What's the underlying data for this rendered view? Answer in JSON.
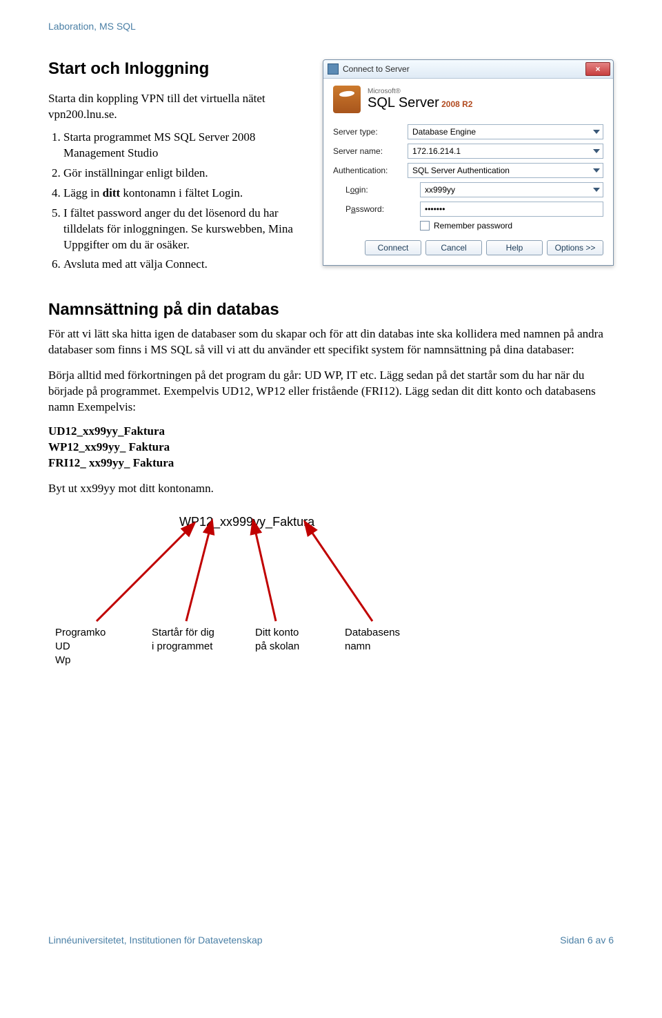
{
  "doc_header": "Laboration, MS SQL",
  "section1": {
    "title": "Start och Inloggning",
    "intro": "Starta din koppling VPN till det virtuella nätet vpn200.lnu.se.",
    "items": {
      "i1": "Starta programmet MS SQL Server 2008 Management Studio",
      "i2": "Gör inställningar enligt bilden.",
      "i3_pre": "Lägg in ",
      "i3_bold": "ditt",
      "i3_post": " kontonamn i fältet Login.",
      "i4": "I fältet password anger du det lösenord du har tilldelats för inloggningen. Se kurswebben, Mina Uppgifter om du är osäker.",
      "i5": "Avsluta med att välja Connect."
    }
  },
  "dialog": {
    "title": "Connect to Server",
    "close": "×",
    "logo": {
      "ms": "Microsoft®",
      "sql": "SQL Server",
      "ver": "2008 R2"
    },
    "labels": {
      "server_type": "Server type:",
      "server_name": "Server name:",
      "auth": "Authentication:",
      "login_pre": "L",
      "login_u": "o",
      "login_post": "gin:",
      "password_pre": "P",
      "password_u": "a",
      "password_post": "ssword:",
      "remember": "Remember password"
    },
    "values": {
      "server_type": "Database Engine",
      "server_name": "172.16.214.1",
      "auth": "SQL Server Authentication",
      "login": "xx999yy",
      "password": "•••••••"
    },
    "buttons": {
      "connect": "Connect",
      "cancel": "Cancel",
      "help": "Help",
      "options": "Options >>"
    }
  },
  "section2": {
    "title": "Namnsättning på din databas",
    "p1": "För att vi lätt ska hitta igen de databaser som du skapar och för att din databas inte ska kollidera med namnen på andra databaser som finns i MS SQL så vill vi att du använder ett specifikt system för namnsättning på dina databaser:",
    "p2": "Börja alltid med förkortningen på det program du går: UD WP, IT etc. Lägg sedan på det startår som du har när du började på programmet. Exempelvis UD12, WP12 eller fristående (FRI12). Lägg sedan dit ditt konto och databasens namn Exempelvis:",
    "ex1": "UD12_xx99yy_Faktura",
    "ex2": "WP12_xx99yy_ Faktura",
    "ex3": "FRI12_ xx99yy_ Faktura",
    "swap": "Byt ut xx99yy mot ditt kontonamn."
  },
  "diagram": {
    "title": "WP12_xx999yy_Faktura",
    "l1a": "Programko",
    "l1b": "UD",
    "l1c": "Wp",
    "l2a": "Startår för dig",
    "l2b": "i programmet",
    "l3a": "Ditt konto",
    "l3b": "på skolan",
    "l4a": "Databasens",
    "l4b": "namn"
  },
  "footer": {
    "left": "Linnéuniversitetet, Institutionen för Datavetenskap",
    "right": "Sidan 6 av 6"
  }
}
